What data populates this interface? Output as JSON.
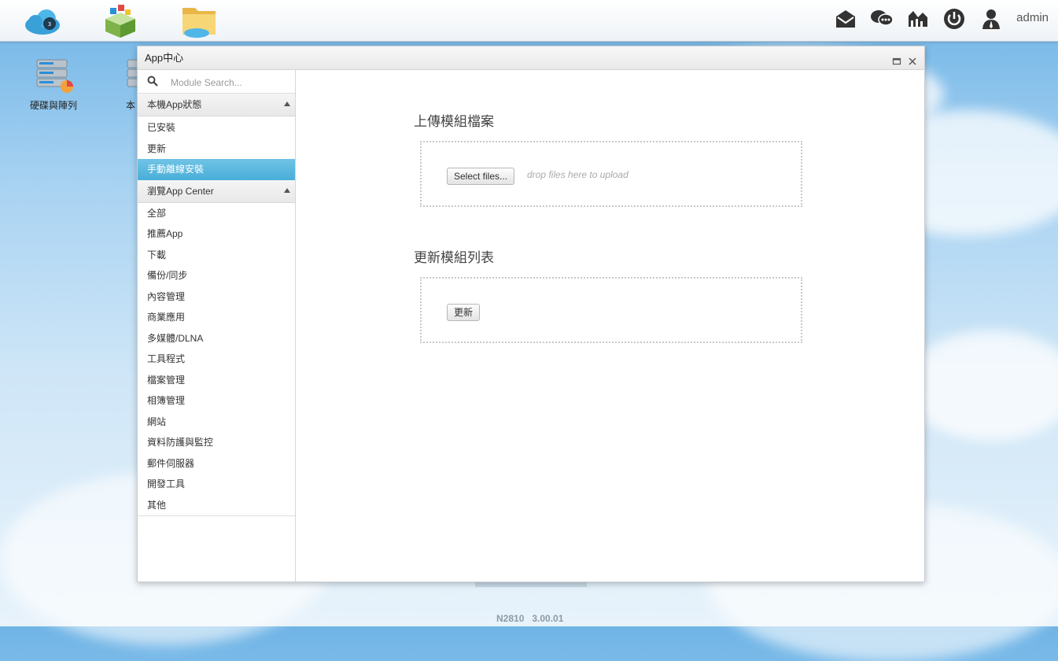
{
  "taskbar": {
    "apps": [
      {
        "icon": "cloud-nas-icon"
      },
      {
        "icon": "app-center-box-icon"
      },
      {
        "icon": "file-center-folder-icon"
      }
    ],
    "tray": [
      {
        "icon": "message-envelope-icon"
      },
      {
        "icon": "chat-bubbles-icon"
      },
      {
        "icon": "system-monitor-icon"
      },
      {
        "icon": "power-icon"
      },
      {
        "icon": "user-icon"
      }
    ],
    "user": "admin"
  },
  "desktop": {
    "icons": [
      {
        "label": "硬碟與陣列",
        "icon": "disk-raid-icon"
      },
      {
        "label": "本",
        "icon": "local-service-icon"
      }
    ],
    "footer_version": "N2810   3.00.01"
  },
  "window": {
    "title": "App中心",
    "search_placeholder": "Module Search...",
    "groups": [
      {
        "label": "本機App狀態",
        "items": [
          "已安裝",
          "更新",
          "手動離線安裝"
        ]
      },
      {
        "label": "瀏覽App Center",
        "items": [
          "全部",
          "推薦App",
          "下載",
          "備份/同步",
          "內容管理",
          "商業應用",
          "多媒體/DLNA",
          "工具程式",
          "檔案管理",
          "相簿管理",
          "網站",
          "資料防護與監控",
          "郵件伺服器",
          "開發工具",
          "其他"
        ]
      }
    ],
    "active_item": "手動離線安裝",
    "upload": {
      "title": "上傳模組檔案",
      "button": "Select files...",
      "hint": "drop files here to upload"
    },
    "update_list": {
      "title": "更新模組列表",
      "button": "更新"
    }
  }
}
